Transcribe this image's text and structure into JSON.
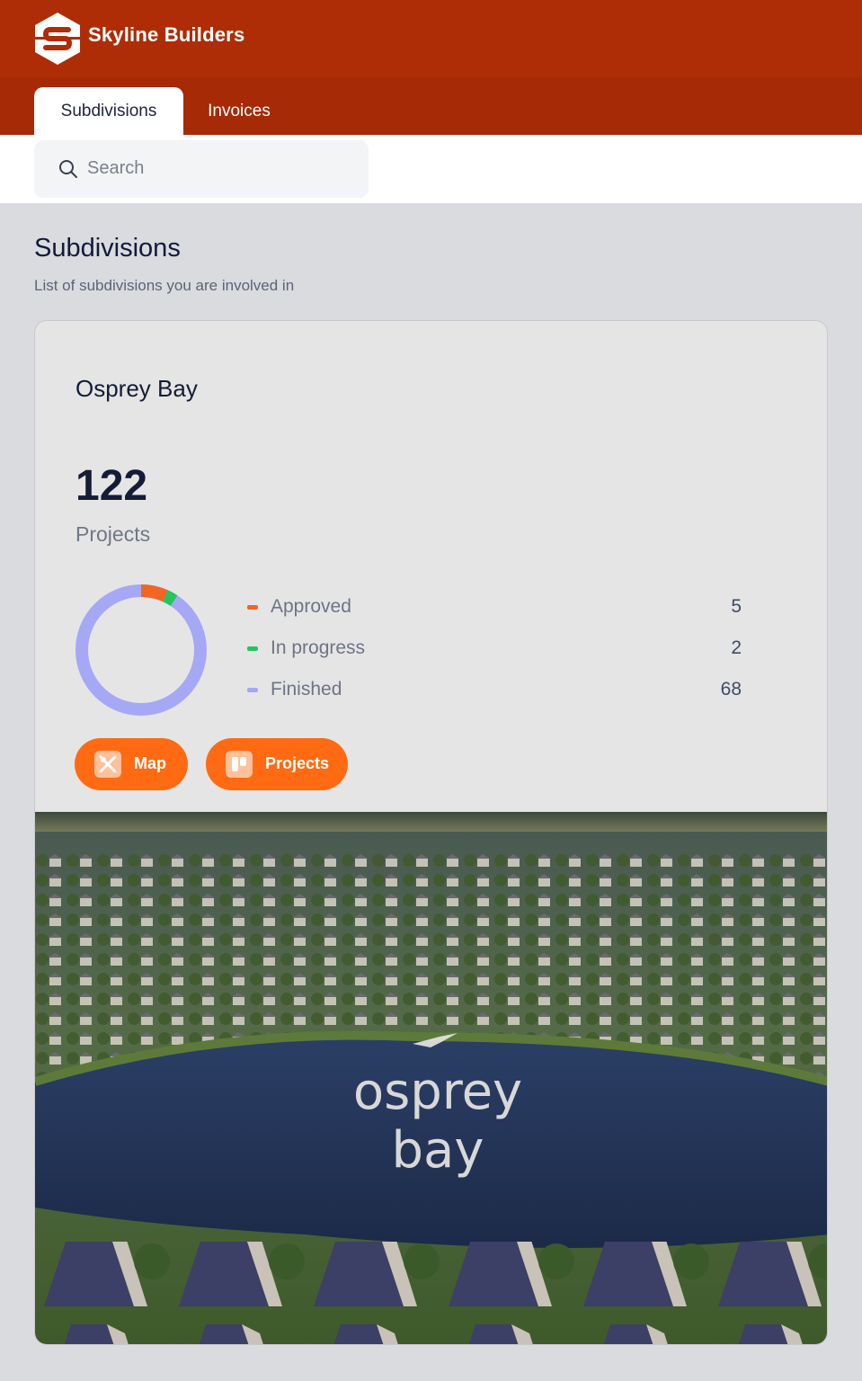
{
  "header": {
    "brand": "Skyline Builders",
    "logo_icon": "hexagon-s-logo-icon",
    "tabs": [
      {
        "label": "Subdivisions",
        "active": true
      },
      {
        "label": "Invoices",
        "active": false
      }
    ]
  },
  "search": {
    "placeholder": "Search",
    "icon": "search-icon"
  },
  "page": {
    "title": "Subdivisions",
    "subtitle": "List of subdivisions you are involved in"
  },
  "subdivision": {
    "name": "Osprey Bay",
    "project_count": "122",
    "project_count_label": "Projects",
    "statuses": [
      {
        "label": "Approved",
        "value": 5,
        "color": "#f26522"
      },
      {
        "label": "In progress",
        "value": 2,
        "color": "#22c55e"
      },
      {
        "label": "Finished",
        "value": 68,
        "color": "#a5a8f5"
      }
    ],
    "buttons": {
      "map": "Map",
      "projects": "Projects"
    },
    "image_text": {
      "line1": "osprey",
      "line2": "bay"
    }
  },
  "colors": {
    "header_bg": "#ae2d06",
    "accent": "#ff6a12",
    "page_bg": "#d9dbdf",
    "card_bg": "#e5e5e5"
  }
}
